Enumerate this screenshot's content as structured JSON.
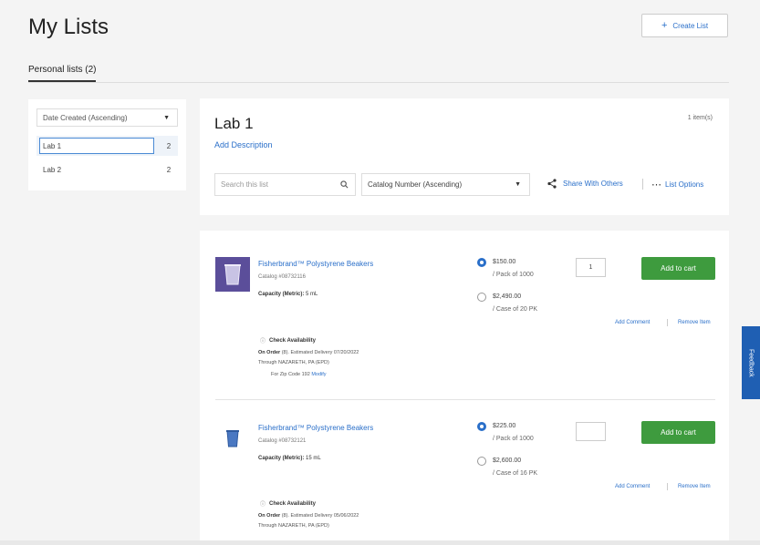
{
  "page": {
    "title": "My Lists",
    "create_label": "Create List",
    "tab_label": "Personal lists (2)"
  },
  "sidebar": {
    "sort_label": "Date Created (Ascending)",
    "lists": [
      {
        "name": "Lab 1",
        "count": "2"
      },
      {
        "name": "Lab 2",
        "count": "2"
      }
    ]
  },
  "list_header": {
    "title": "Lab 1",
    "item_count": "1 item(s)",
    "add_description": "Add Description",
    "search_placeholder": "Search this list",
    "sort_label": "Catalog Number (Ascending)",
    "share_label": "Share With Others",
    "options_label": "List Options"
  },
  "items": [
    {
      "name": "Fisherbrand™ Polystyrene Beakers",
      "catalog": "Catalog #08732116",
      "capacity_label": "Capacity (Metric):",
      "capacity_value": "5 mL",
      "availability_title": "Check Availability",
      "order_label": "On Order",
      "order_text": "(8). Estimated Delivery 07/20/2022",
      "through": "Through NAZARETH, PA (EPD)",
      "zip_text": "For Zip Code 192",
      "zip_link": "Modify",
      "price1": "$150.00",
      "pack1": "/ Pack of 1000",
      "price2": "$2,490.00",
      "pack2": "/ Case of 20 PK",
      "qty": "1",
      "cart_label": "Add to cart",
      "add_comment": "Add Comment",
      "remove": "Remove Item"
    },
    {
      "name": "Fisherbrand™ Polystyrene Beakers",
      "catalog": "Catalog #08732121",
      "capacity_label": "Capacity (Metric):",
      "capacity_value": "15 mL",
      "availability_title": "Check Availability",
      "order_label": "On Order",
      "order_text": "(8). Estimated Delivery 05/06/2022",
      "through": "Through NAZARETH, PA (EPD)",
      "price1": "$225.00",
      "pack1": "/ Pack of 1000",
      "price2": "$2,600.00",
      "pack2": "/ Case of 16 PK",
      "qty": "",
      "cart_label": "Add to cart",
      "add_comment": "Add Comment",
      "remove": "Remove Item"
    }
  ],
  "feedback_label": "Feedback",
  "colors": {
    "accent": "#2a6fc9",
    "cart": "#3e9b3e",
    "feedback": "#1f5fb3"
  }
}
